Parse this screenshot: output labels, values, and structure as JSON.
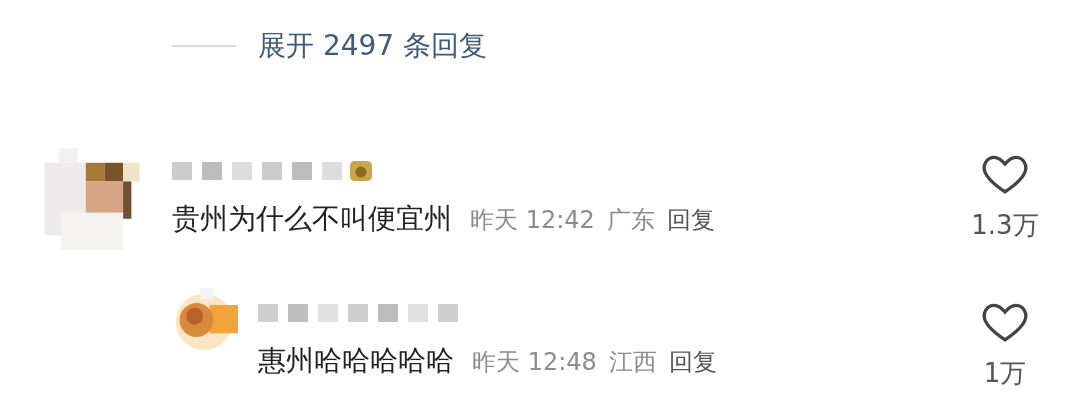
{
  "expand_replies": {
    "label": "展开 2497 条回复"
  },
  "comments": [
    {
      "has_badge": true,
      "text": "贵州为什么不叫便宜州",
      "time": "昨天 12:42",
      "location": "广东",
      "reply_label": "回复",
      "likes": "1.3万",
      "liked": false,
      "replies": [
        {
          "has_badge": false,
          "text": "惠州哈哈哈哈哈",
          "time": "昨天 12:48",
          "location": "江西",
          "reply_label": "回复",
          "likes": "1万",
          "liked": false
        }
      ]
    }
  ]
}
